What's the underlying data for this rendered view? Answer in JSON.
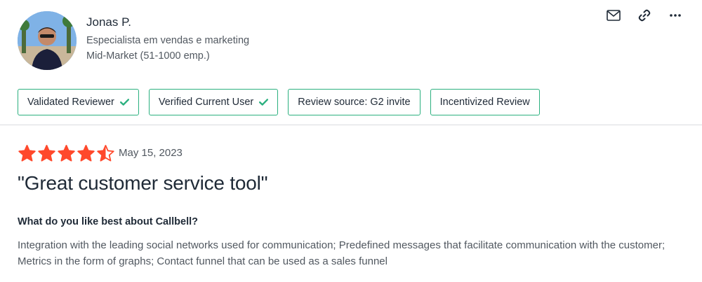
{
  "reviewer": {
    "name": "Jonas P.",
    "title": "Especialista em vendas e marketing",
    "segment": "Mid-Market (51-1000 emp.)",
    "avatar_icon": "reviewer-photo"
  },
  "actions": [
    "mail-icon",
    "link-icon",
    "more-icon"
  ],
  "badges": [
    {
      "label": "Validated Reviewer",
      "checked": true
    },
    {
      "label": "Verified Current User",
      "checked": true
    },
    {
      "label": "Review source: G2 invite",
      "checked": false
    },
    {
      "label": "Incentivized Review",
      "checked": false
    }
  ],
  "review": {
    "rating": 4.5,
    "rating_max": 5,
    "date": "May 15, 2023",
    "title": "\"Great customer service tool\"",
    "question": "What do you like best about Callbell?",
    "answer": "Integration with the leading social networks used for communication; Predefined messages that facilitate communication with the customer; Metrics in the form of graphs; Contact funnel that can be used as a sales funnel"
  },
  "colors": {
    "star": "#ff492c",
    "badge_border": "#2bb07f",
    "check": "#2bb07f",
    "text_primary": "#1f2a37",
    "text_secondary": "#515860"
  }
}
